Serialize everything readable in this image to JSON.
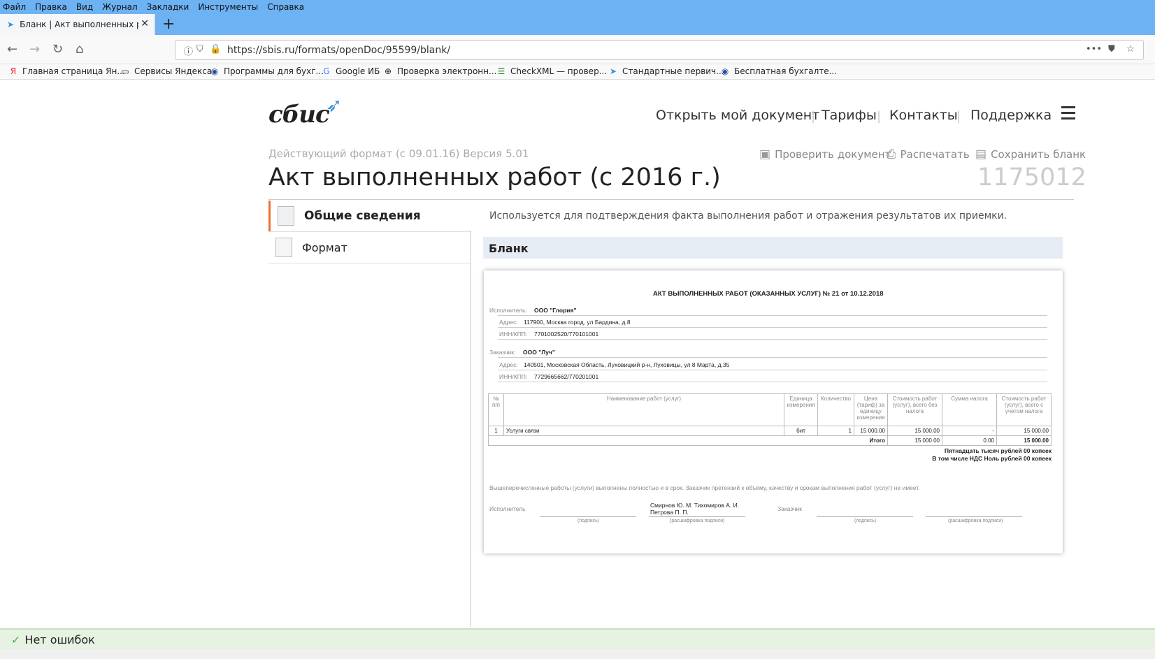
{
  "menu": [
    "Файл",
    "Правка",
    "Вид",
    "Журнал",
    "Закладки",
    "Инструменты",
    "Справка"
  ],
  "tab": {
    "title": "Бланк | Акт выполненных раб"
  },
  "url": "https://sbis.ru/formats/openDoc/95599/blank/",
  "bookmarks": [
    "Главная страница Ян...",
    "Сервисы Яндекса",
    "Программы для бухг...",
    "Google ИБ",
    "Проверка электронн...",
    "CheckXML — провер...",
    "Стандартные первич...",
    "Бесплатная бухгалте..."
  ],
  "logo": "сбис",
  "nav": [
    "Открыть мой документ",
    "Тарифы",
    "Контакты",
    "Поддержка"
  ],
  "subtitle": "Действующий формат (с 09.01.16) Версия 5.01",
  "actions": {
    "check": "Проверить документ",
    "print": "Распечатать",
    "save": "Сохранить бланк"
  },
  "title": "Акт выполненных работ (с 2016 г.)",
  "code": "1175012",
  "sidebar": [
    {
      "label": "Общие сведения"
    },
    {
      "label": "Формат"
    }
  ],
  "description": "Используется для подтверждения факта выполнения работ и отражения результатов их приемки.",
  "blank_header": "Бланк",
  "doc": {
    "title": "АКТ ВЫПОЛНЕННЫХ РАБОТ (ОКАЗАННЫХ УСЛУГ) № 21 от 10.12.2018",
    "exec_label": "Исполнитель:",
    "exec_name": "ООО \"Глория\"",
    "addr_label": "Адрес:",
    "exec_addr": "117900, Москва город, ул Бардина, д.8",
    "inn_label": "ИНН/КПП:",
    "exec_inn": "7701002520/770101001",
    "cust_label": "Заказчик:",
    "cust_name": "ООО \"Луч\"",
    "cust_addr": "140501, Московская Область, Луховицкий р-н, Луховицы, ул 8 Марта, д.35",
    "cust_inn": "7729665662/770201001",
    "columns": [
      "№ п/п",
      "Наименование работ (услуг)",
      "Единица измерения",
      "Количество",
      "Цена (тариф) за единицу измерения",
      "Стоимость работ (услуг), всего без налога",
      "Сумма налога",
      "Стоимость работ (услуг), всего с учетом налога"
    ],
    "row": [
      "1",
      "Услуги связи",
      "бит",
      "1",
      "15 000.00",
      "15 000.00",
      "-",
      "15 000.00"
    ],
    "total_label": "Итого",
    "total_net": "15 000.00",
    "total_tax": "0.00",
    "total_gross": "15 000.00",
    "sum_words": "Пятнадцать тысяч рублей 00 копеек",
    "vat_words": "В том числе НДС  Ноль рублей 00 копеек",
    "note": "Вышеперечисленные работы (услуги) выполнены полностью и в срок. Заказчик претензий к объёму, качеству и срокам выполнения работ (услуг) не имеет.",
    "sig_exec": "Исполнитель",
    "sig_cust": "Заказчик",
    "signers_1": "Смирнов Ю. М. Тихомиров А. И.",
    "signers_2": "Петрова П. П.",
    "sign_caption": "(подпись)",
    "decode_caption": "(расшифровка подписи)"
  },
  "status": "Нет ошибок"
}
